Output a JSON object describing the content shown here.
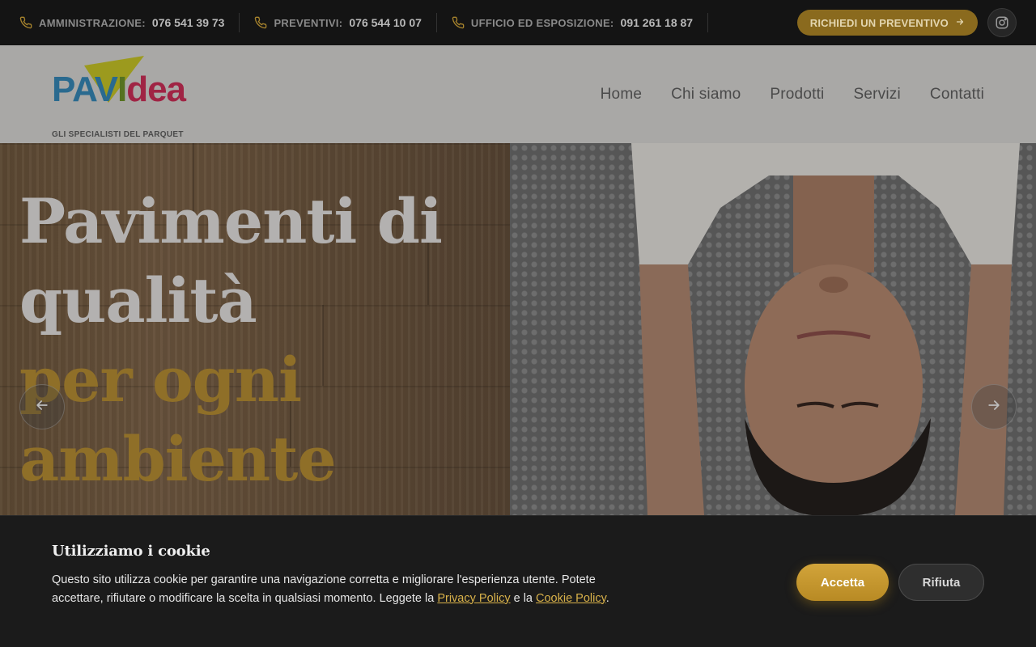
{
  "topbar": {
    "contacts": [
      {
        "label": "AMMINISTRAZIONE:",
        "number": "076 541 39 73"
      },
      {
        "label": "PREVENTIVI:",
        "number": "076 544 10 07"
      },
      {
        "label": "UFFICIO ED ESPOSIZIONE:",
        "number": "091 261 18 87"
      }
    ],
    "quote_button": "RICHIEDI UN PREVENTIVO",
    "icons": {
      "phone": "phone-icon",
      "arrow": "arrow-right-icon",
      "social": "instagram-icon"
    },
    "accent_color": "#a8842d"
  },
  "header": {
    "logo": {
      "part1": "PAV",
      "part2": "I",
      "part3": "dea",
      "tagline": "GLI SPECIALISTI DEL PARQUET"
    },
    "nav": [
      "Home",
      "Chi siamo",
      "Prodotti",
      "Servizi",
      "Contatti"
    ]
  },
  "hero": {
    "title_line1": "Pavimenti di",
    "title_line2": "qualità",
    "title_line3": "per ogni",
    "title_line4": "ambiente",
    "prev_icon": "arrow-left-icon",
    "next_icon": "arrow-right-icon"
  },
  "cookie": {
    "title": "Utilizziamo i cookie",
    "text_before": "Questo sito utilizza cookie per garantire una navigazione corretta e migliorare l'esperienza utente. Potete accettare, rifiutare o modificare la scelta in qualsiasi momento. Leggete la ",
    "privacy_link": "Privacy Policy",
    "text_middle": " e la ",
    "cookie_link": "Cookie Policy",
    "text_after": ".",
    "accept": "Accetta",
    "reject": "Rifiuta",
    "accept_color": "#c99a30"
  }
}
